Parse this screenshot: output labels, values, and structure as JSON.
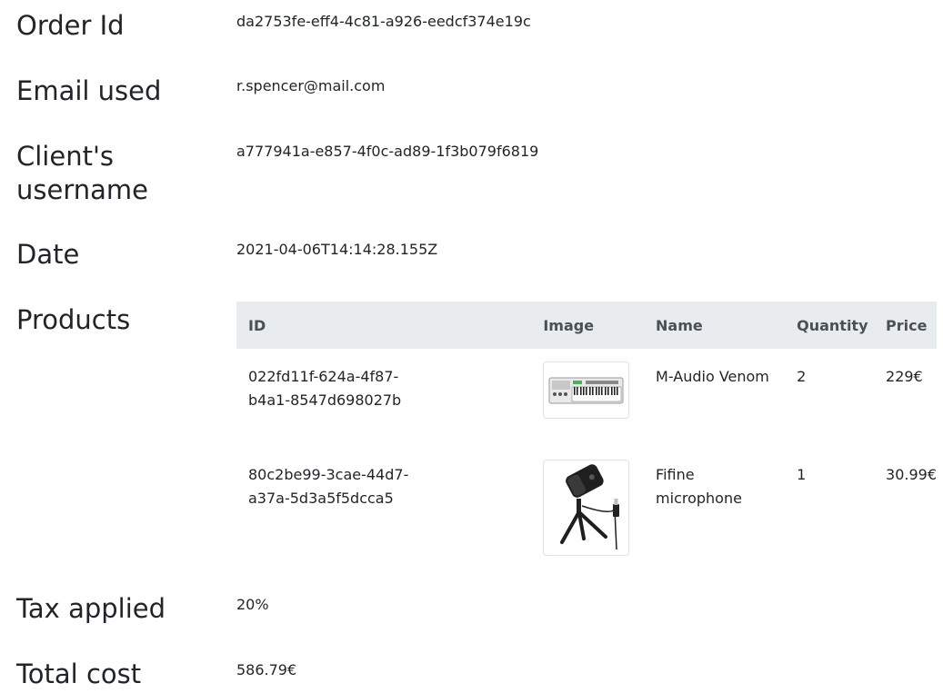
{
  "fields": {
    "order_id": {
      "label": "Order Id",
      "value": "da2753fe-eff4-4c81-a926-eedcf374e19c"
    },
    "email": {
      "label": "Email used",
      "value": "r.spencer@mail.com"
    },
    "username": {
      "label_line1": "Client's",
      "label_line2": "username",
      "value": "a777941a-e857-4f0c-ad89-1f3b079f6819"
    },
    "date": {
      "label": "Date",
      "value": "2021-04-06T14:14:28.155Z"
    },
    "products": {
      "label": "Products"
    },
    "tax": {
      "label": "Tax applied",
      "value": "20%"
    },
    "total": {
      "label": "Total cost",
      "value": "586.79€"
    }
  },
  "table": {
    "headers": [
      "ID",
      "Image",
      "Name",
      "Quantity",
      "Price"
    ],
    "rows": [
      {
        "id_line1": "022fd11f-624a-4f87-",
        "id_line2": "b4a1-8547d698027b",
        "image": "midi-keyboard-image",
        "name_line1": "M-Audio Venom",
        "name_line2": "",
        "quantity": "2",
        "price": "229€"
      },
      {
        "id_line1": "80c2be99-3cae-44d7-",
        "id_line2": "a37a-5d3a5f5dcca5",
        "image": "microphone-image",
        "name_line1": "Fifine",
        "name_line2": "microphone",
        "quantity": "1",
        "price": "30.99€"
      }
    ]
  }
}
